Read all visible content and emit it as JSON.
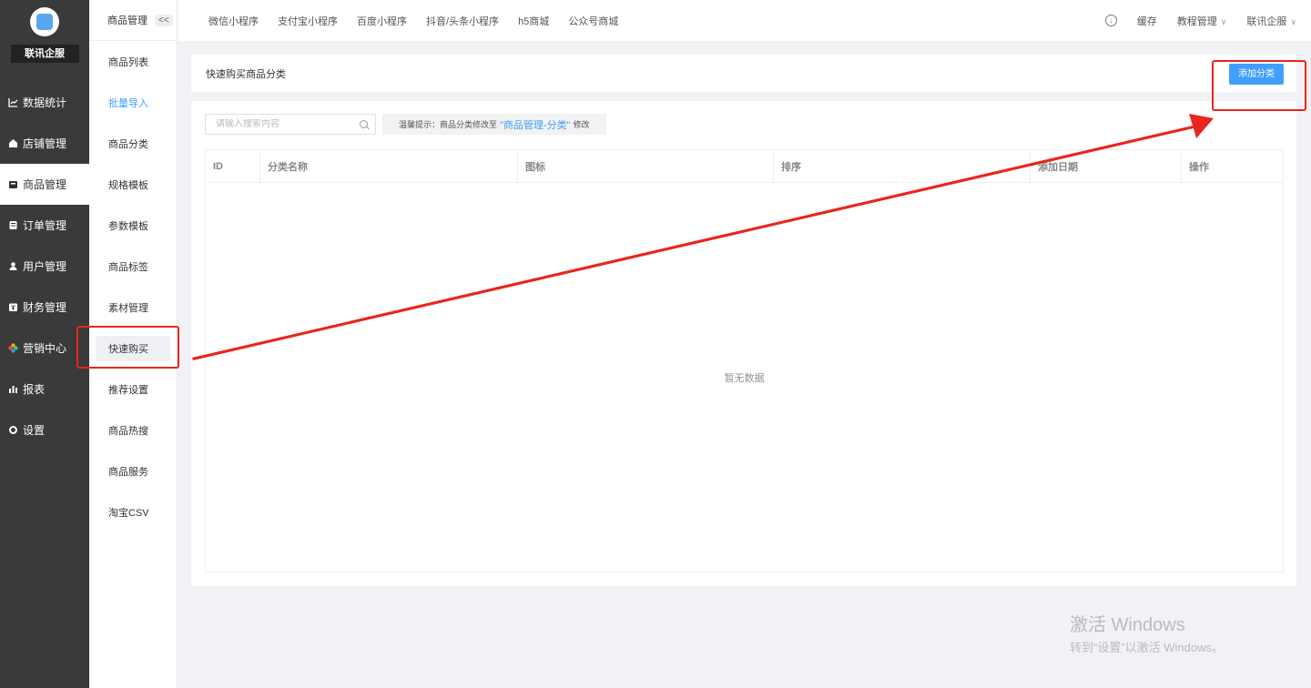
{
  "app": {
    "brand": "联讯企服",
    "brand_color": "#409eff"
  },
  "main_nav": [
    {
      "label": "数据统计",
      "icon": "chart-line-icon"
    },
    {
      "label": "店铺管理",
      "icon": "store-icon"
    },
    {
      "label": "商品管理",
      "icon": "product-box-icon"
    },
    {
      "label": "订单管理",
      "icon": "order-icon"
    },
    {
      "label": "用户管理",
      "icon": "user-icon"
    },
    {
      "label": "财务管理",
      "icon": "finance-icon"
    },
    {
      "label": "营销中心",
      "icon": "marketing-icon"
    },
    {
      "label": "报表",
      "icon": "bar-chart-icon"
    },
    {
      "label": "设置",
      "icon": "gear-icon"
    }
  ],
  "sub_nav": {
    "title": "商品管理",
    "collapse": "<<",
    "items": [
      {
        "label": "商品列表"
      },
      {
        "label": "批量导入"
      },
      {
        "label": "商品分类"
      },
      {
        "label": "规格模板"
      },
      {
        "label": "参数模板"
      },
      {
        "label": "商品标签"
      },
      {
        "label": "素材管理"
      },
      {
        "label": "快速购买"
      },
      {
        "label": "推荐设置"
      },
      {
        "label": "商品热搜"
      },
      {
        "label": "商品服务"
      },
      {
        "label": "淘宝CSV"
      }
    ]
  },
  "topbar": {
    "tabs": [
      "微信小程序",
      "支付宝小程序",
      "百度小程序",
      "抖音/头条小程序",
      "h5商城",
      "公众号商城"
    ],
    "cache": "缓存",
    "tutorial": "教程管理",
    "account": "联讯企服"
  },
  "page": {
    "title": "快速购买商品分类",
    "add_button": "添加分类"
  },
  "search": {
    "placeholder": "请输入搜索内容"
  },
  "tip": {
    "prefix": "温馨提示：商品分类修改至",
    "link": "\"商品管理-分类\"",
    "suffix": "修改"
  },
  "table": {
    "columns": [
      "ID",
      "分类名称",
      "图标",
      "排序",
      "添加日期",
      "操作"
    ],
    "empty_text": "暂无数据"
  },
  "watermark": {
    "title": "激活 Windows",
    "subtitle": "转到“设置”以激活 Windows。"
  }
}
